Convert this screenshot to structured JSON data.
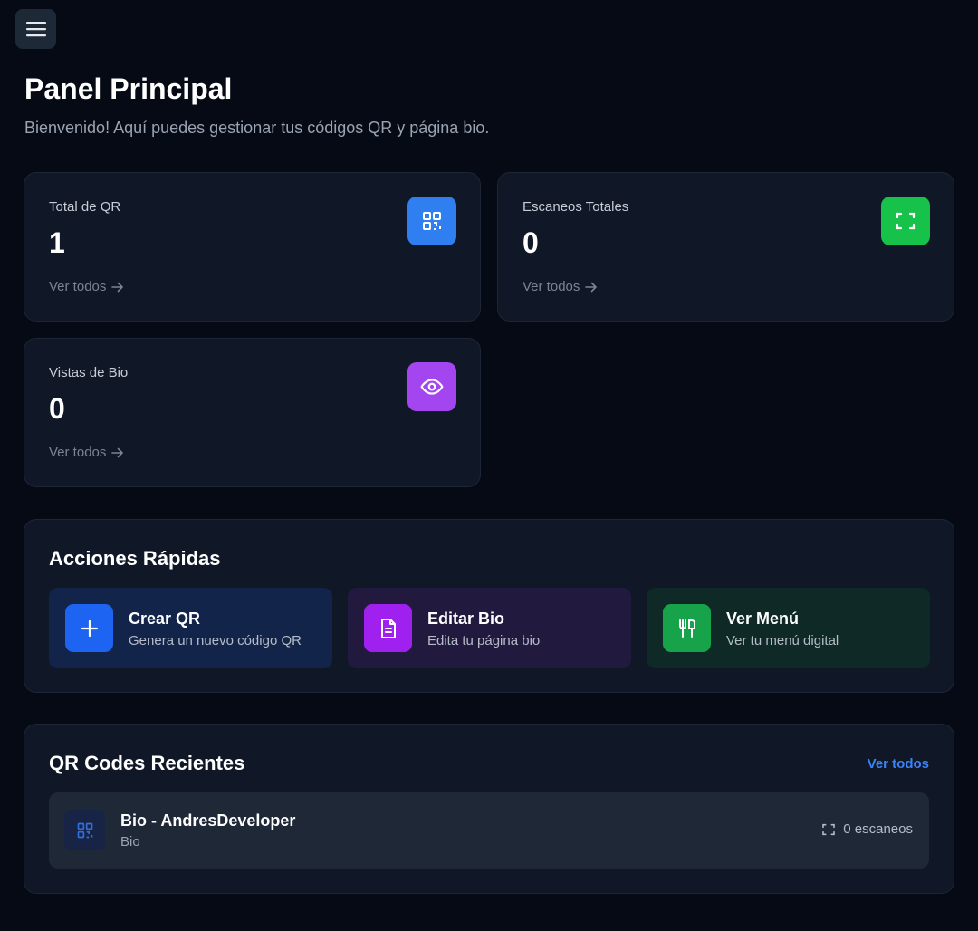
{
  "header": {
    "menu_icon": "hamburger-icon",
    "title": "Panel Principal",
    "subtitle": "Bienvenido! Aquí puedes gestionar tus códigos QR y página bio."
  },
  "stats": [
    {
      "label": "Total de QR",
      "value": "1",
      "link": "Ver todos",
      "icon": "qr-code-icon",
      "color": "#2f7ff0"
    },
    {
      "label": "Escaneos Totales",
      "value": "0",
      "link": "Ver todos",
      "icon": "scan-icon",
      "color": "#16c24a"
    },
    {
      "label": "Vistas de Bio",
      "value": "0",
      "link": "Ver todos",
      "icon": "eye-icon",
      "color": "#a446f0"
    }
  ],
  "quick_actions": {
    "title": "Acciones Rápidas",
    "items": [
      {
        "title": "Crear QR",
        "subtitle": "Genera un nuevo código QR",
        "icon": "plus-icon",
        "color": "#1d64f2",
        "bg": "#13244a"
      },
      {
        "title": "Editar Bio",
        "subtitle": "Edita tu página bio",
        "icon": "document-icon",
        "color": "#a020f0",
        "bg": "#221a3e"
      },
      {
        "title": "Ver Menú",
        "subtitle": "Ver tu menú digital",
        "icon": "utensils-icon",
        "color": "#16a34a",
        "bg": "#0f2a26"
      }
    ]
  },
  "recent": {
    "title": "QR Codes Recientes",
    "see_all": "Ver todos",
    "items": [
      {
        "name": "Bio - AndresDeveloper",
        "type": "Bio",
        "scans": "0 escaneos",
        "icon": "qr-code-icon"
      }
    ]
  }
}
